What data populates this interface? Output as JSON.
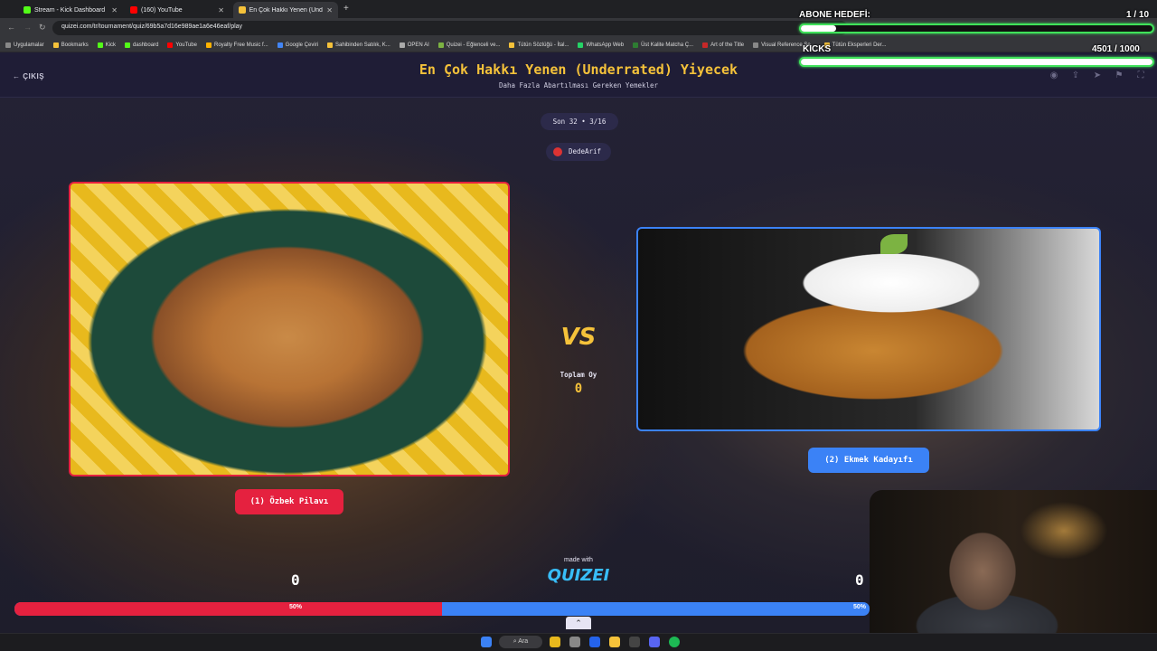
{
  "browser": {
    "tabs": [
      {
        "label": "Stream - Kick Dashboard",
        "color": "#53fc18"
      },
      {
        "label": "(160) YouTube",
        "color": "#ff0000"
      },
      {
        "label": "En Çok Hakkı Yenen (Underrate",
        "color": "#f5c23a"
      }
    ],
    "url": "quizei.com/tr/tournament/quiz/69b5a7d16e989ae1a6e46eaf/play",
    "bookmarks": [
      "Uygulamalar",
      "Bookmarks",
      "Kick",
      "dashboard",
      "YouTube",
      "Royalty Free Music f...",
      "Google Çeviri",
      "Sahibinden Satılık, K...",
      "OPEN AI",
      "Quizei - Eğlenceli ve...",
      "Tütün Sözlüğü - İtal...",
      "WhatsApp Web",
      "Üst Kalite Matcha Ç...",
      "Art of the Title",
      "Visual Reference Se...",
      "Tütün Eksperleri Der..."
    ]
  },
  "page": {
    "exit_label": "ÇIKIŞ",
    "title": "En Çok Hakkı Yenen (Underrated) Yiyecek",
    "subtitle": "Daha Fazla Abartılması Gereken Yemekler",
    "round": "Son 32 • 3/16",
    "author": "DedeArif",
    "vs_label": "VS",
    "total_label": "Toplam Oy",
    "total_votes": "0",
    "left_choice": {
      "label": "(1) Özbek Pilavı",
      "score": "0",
      "percent": "50%",
      "color": "#e5213f"
    },
    "right_choice": {
      "label": "(2) Ekmek Kadayıfı",
      "score": "0",
      "percent": "50%",
      "color": "#3b82f6"
    },
    "left_share": 0.5,
    "made_with": "made with",
    "logo": "QUIZEI"
  },
  "overlay": {
    "subs_title": "ABONE HEDEFİ:",
    "subs_count": "1 / 10",
    "subs_fraction": 0.1,
    "kicks_title": "KICKS",
    "kicks_count": "4501 / 1000",
    "kicks_fraction": 1.0
  },
  "taskbar": {
    "search": "Ara"
  }
}
